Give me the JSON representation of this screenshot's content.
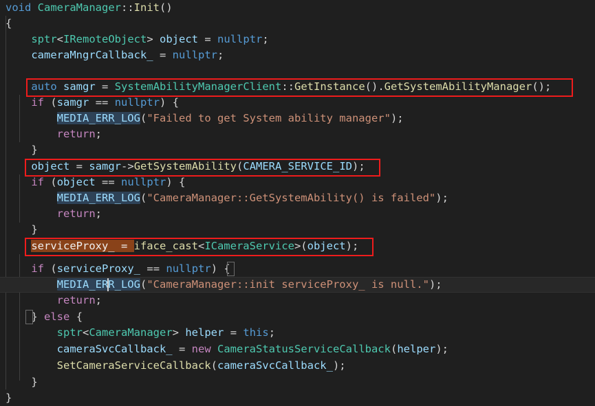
{
  "editor": {
    "language": "C++",
    "background_color": "#1f1f1f",
    "default_text_color": "#d4d4d4",
    "font_size_px": 15.5,
    "line_height_px": 23
  },
  "colors": {
    "keyword": "#569cd6",
    "control_keyword": "#c586c0",
    "type_name": "#4ec9b0",
    "function_name": "#dcdcaa",
    "variable": "#9cdcfe",
    "string_literal": "#ce9178",
    "punctuation": "#d4d4d4",
    "annotation_box": "#ef1c1c",
    "selection_highlight": "#894219",
    "occurrence_highlight": "#2e4257",
    "current_line": "#282828",
    "indent_guide": "#404040"
  },
  "code": {
    "lines": [
      "void CameraManager::Init()",
      "{",
      "    sptr<IRemoteObject> object = nullptr;",
      "    cameraMngrCallback_ = nullptr;",
      "",
      "    auto samgr = SystemAbilityManagerClient::GetInstance().GetSystemAbilityManager();",
      "    if (samgr == nullptr) {",
      "        MEDIA_ERR_LOG(\"Failed to get System ability manager\");",
      "        return;",
      "    }",
      "    object = samgr->GetSystemAbility(CAMERA_SERVICE_ID);",
      "    if (object == nullptr) {",
      "        MEDIA_ERR_LOG(\"CameraManager::GetSystemAbility() is failed\");",
      "        return;",
      "    }",
      "    serviceProxy_ = iface_cast<ICameraService>(object);",
      "    if (serviceProxy_ == nullptr) {",
      "        MEDIA_ERR_LOG(\"CameraManager::init serviceProxy_ is null.\");",
      "        return;",
      "    } else {",
      "        sptr<CameraManager> helper = this;",
      "        cameraSvcCallback_ = new CameraStatusServiceCallback(helper);",
      "        SetCameraServiceCallback(cameraSvcCallback_);",
      "    }",
      "}"
    ]
  },
  "annotations": {
    "red_boxes": [
      {
        "label": "highlight-samgr-line",
        "code_line": "auto samgr = SystemAbilityManagerClient::GetInstance().GetSystemAbilityManager();"
      },
      {
        "label": "highlight-getsystemability",
        "code_line": "object = samgr->GetSystemAbility(CAMERA_SERVICE_ID);"
      },
      {
        "label": "highlight-iface-cast",
        "code_line": "serviceProxy_ = iface_cast<ICameraService>(object);"
      }
    ],
    "selection_text": "serviceProxy_ = ",
    "occurrence_text": "MEDIA_ERR_LOG",
    "caret_line_text": "        MEDIA_ERR_LOG(\"CameraManager::init serviceProxy_ is null.\");"
  }
}
